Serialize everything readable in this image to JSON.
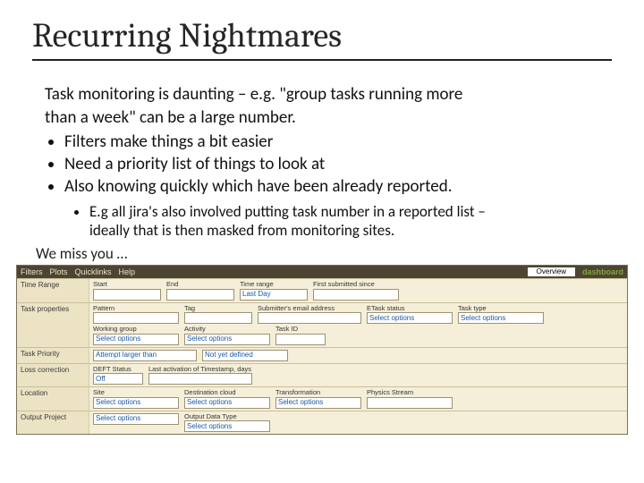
{
  "title": "Recurring Nightmares",
  "intro1": "Task monitoring is daunting – e.g. \"group tasks running more",
  "intro2": "than a week\" can be a large number.",
  "bullets": [
    "Filters make things a bit easier",
    "Need a priority list of things to look at",
    "Also knowing quickly which have been already reported."
  ],
  "sub1a": "E.g all jira's also involved putting task number in a reported list –",
  "sub1b": "ideally that is then masked from monitoring sites.",
  "miss": "We miss you …",
  "dash": {
    "menu": [
      "Filters",
      "Plots",
      "Quicklinks",
      "Help"
    ],
    "status_label": "Overview",
    "brand": "dashboard",
    "sections": [
      {
        "label": "Time Range",
        "fields": [
          {
            "l": "Start",
            "v": "",
            "w": "w70"
          },
          {
            "l": "End",
            "v": "",
            "w": "w70"
          },
          {
            "l": "Time range",
            "v": "Last Day",
            "w": "w70"
          },
          {
            "l": "First submitted since",
            "v": "",
            "w": "w90"
          }
        ]
      },
      {
        "label": "Task properties",
        "fields": [
          {
            "l": "Pattern",
            "v": "",
            "w": "w90"
          },
          {
            "l": "Tag",
            "v": "",
            "w": "w70"
          },
          {
            "l": "Submitter's email address",
            "v": "",
            "w": "w110"
          },
          {
            "l": "ETask status",
            "v": "Select options",
            "w": "w90"
          },
          {
            "l": "Task type",
            "v": "Select options",
            "w": "w90"
          },
          {
            "l": "Working group",
            "v": "Select options",
            "w": "w90"
          },
          {
            "l": "Activity",
            "v": "Select options",
            "w": "w90"
          },
          {
            "l": "Task ID",
            "v": "",
            "w": "w50"
          }
        ]
      },
      {
        "label": "Task Priority",
        "fields": [
          {
            "l": "",
            "v": "Attempt larger than",
            "w": "w110"
          },
          {
            "l": "",
            "v": "Not yet defined",
            "w": "w90"
          }
        ]
      },
      {
        "label": "Loss correction",
        "fields": [
          {
            "l": "DEFT Status",
            "v": "Off",
            "w": "w50"
          },
          {
            "l": "Last activation of Timestamp, days",
            "v": "",
            "w": "w110"
          }
        ]
      },
      {
        "label": "Location",
        "fields": [
          {
            "l": "Site",
            "v": "Select options",
            "w": "w90"
          },
          {
            "l": "Destination cloud",
            "v": "Select options",
            "w": "w90"
          },
          {
            "l": "Transformation",
            "v": "Select options",
            "w": "w90"
          },
          {
            "l": "Physics Stream",
            "v": "",
            "w": "w90"
          }
        ]
      },
      {
        "label": "Output Project",
        "fields": [
          {
            "l": "",
            "v": "Select options",
            "w": "w90"
          },
          {
            "l": "Output Data Type",
            "v": "Select options",
            "w": "w90"
          }
        ]
      }
    ]
  }
}
